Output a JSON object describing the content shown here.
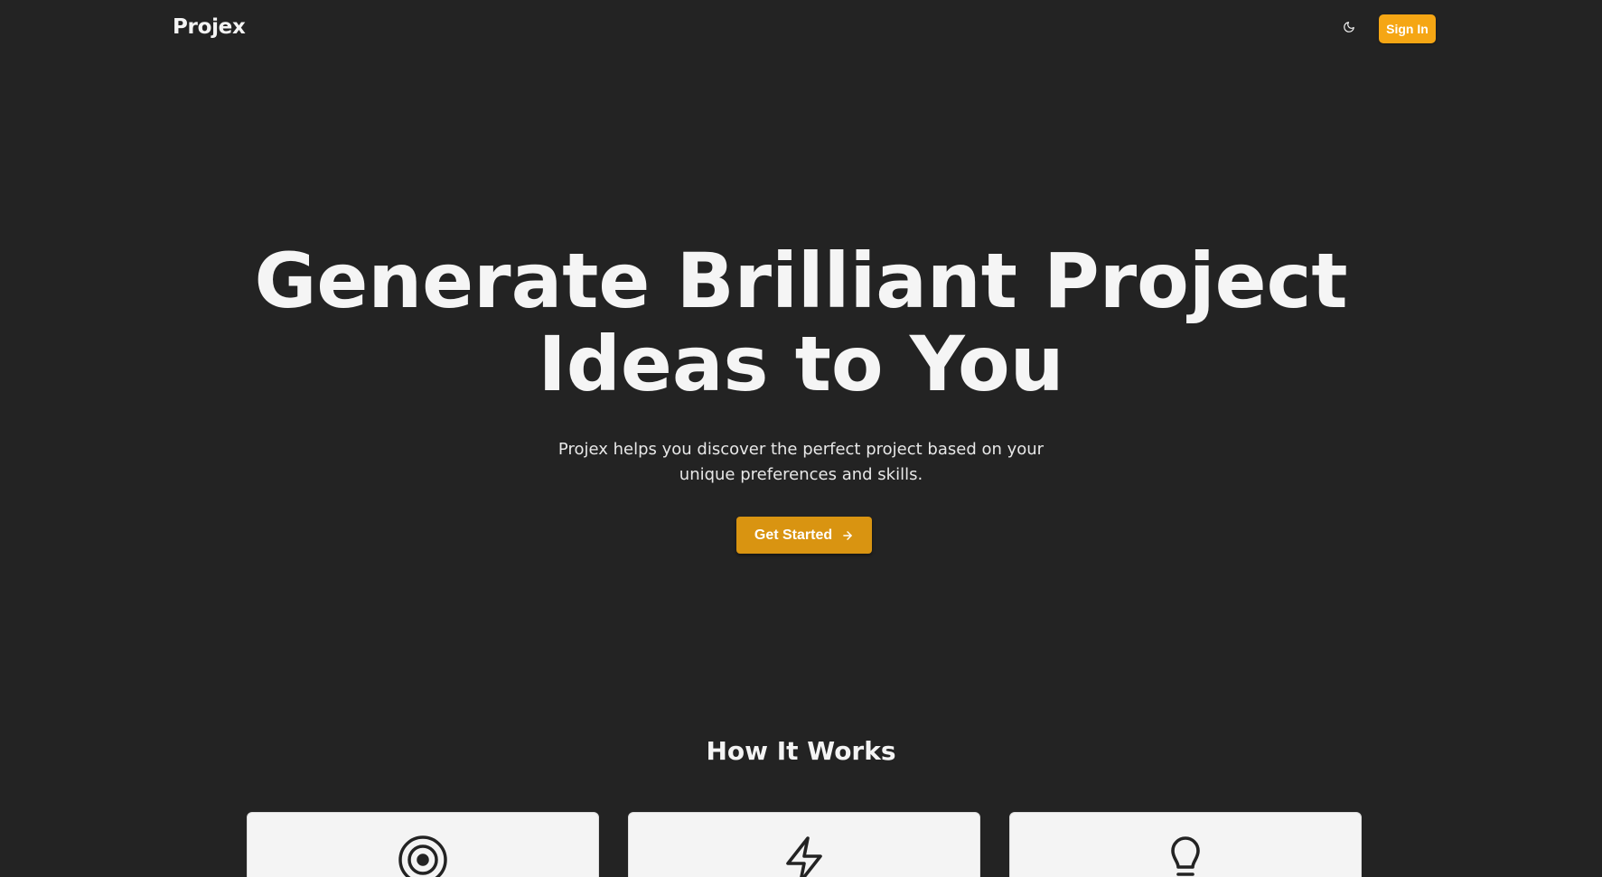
{
  "header": {
    "brand": "Projex",
    "theme_toggle_icon": "moon-icon",
    "signin_label": "Sign In"
  },
  "hero": {
    "title_line1": "Generate Brilliant Project",
    "title_line2": "Ideas to You",
    "subtitle": "Projex helps you discover the perfect project based on your unique preferences and skills.",
    "cta_label": "Get Started",
    "cta_icon": "arrow-right-icon"
  },
  "how_it_works": {
    "title": "How It Works",
    "cards": [
      {
        "icon": "target-icon"
      },
      {
        "icon": "lightning-icon"
      },
      {
        "icon": "lightbulb-icon"
      }
    ]
  },
  "colors": {
    "background": "#232323",
    "accent": "#f5a614",
    "accent_dark": "#d99411",
    "card_background": "#f4f4f4",
    "text": "#f4f4f4"
  }
}
